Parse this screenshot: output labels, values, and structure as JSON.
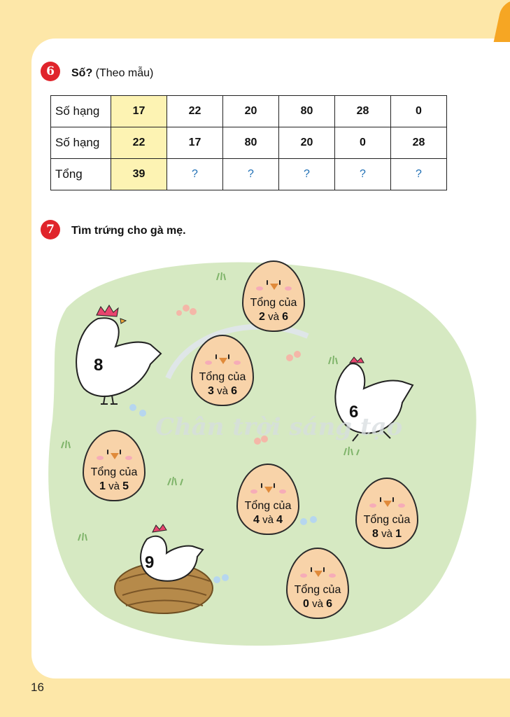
{
  "page_number": "16",
  "exercise6": {
    "number": "6",
    "title_bold": "Số?",
    "title_rest": " (Theo mẫu)",
    "rows": [
      {
        "label": "Số hạng",
        "cells": [
          "17",
          "22",
          "20",
          "80",
          "28",
          "0"
        ]
      },
      {
        "label": "Số hạng",
        "cells": [
          "22",
          "17",
          "80",
          "20",
          "0",
          "28"
        ]
      },
      {
        "label": "Tổng",
        "cells": [
          "39",
          "?",
          "?",
          "?",
          "?",
          "?"
        ]
      }
    ]
  },
  "exercise7": {
    "number": "7",
    "title": "Tìm trứng cho gà mẹ.",
    "hens": [
      "8",
      "6",
      "9"
    ],
    "eggs": [
      {
        "text": "Tổng của",
        "a": "2",
        "and": "và",
        "b": "6"
      },
      {
        "text": "Tổng của",
        "a": "3",
        "and": "và",
        "b": "6"
      },
      {
        "text": "Tổng của",
        "a": "1",
        "and": "và",
        "b": "5"
      },
      {
        "text": "Tổng của",
        "a": "4",
        "and": "và",
        "b": "4"
      },
      {
        "text": "Tổng của",
        "a": "8",
        "and": "và",
        "b": "1"
      },
      {
        "text": "Tổng của",
        "a": "0",
        "and": "và",
        "b": "6"
      }
    ],
    "watermark": "Chân trời sáng tạo"
  },
  "colors": {
    "badge": "#e0242b",
    "page_bg": "#fde7a8",
    "sample_cell": "#fdf3b3",
    "question": "#1f6fb5",
    "egg": "#f8d3a9",
    "grass": "#d6e9c2"
  }
}
